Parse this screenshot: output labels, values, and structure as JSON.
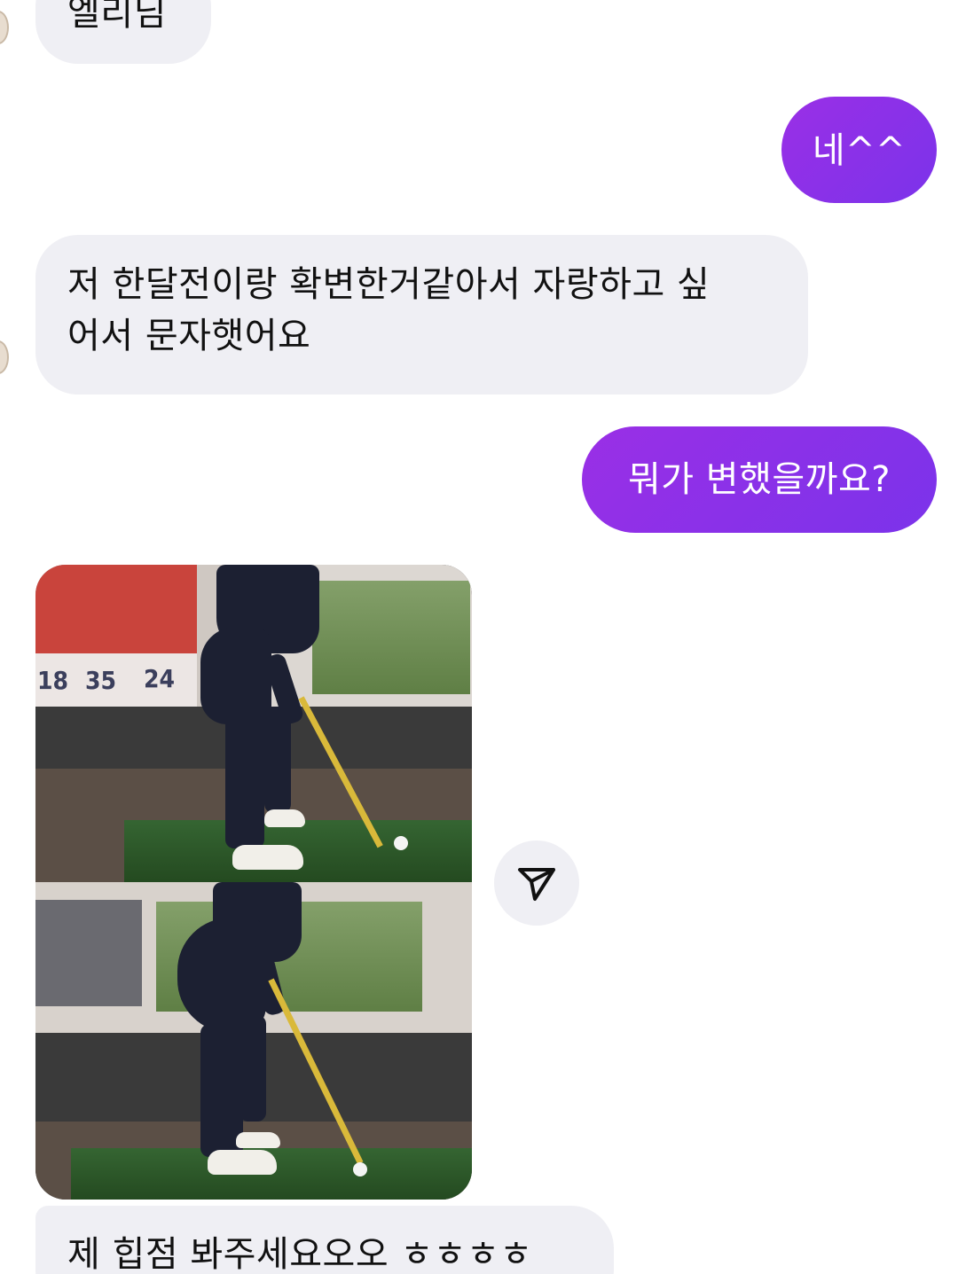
{
  "messages": [
    {
      "id": "m1",
      "direction": "incoming",
      "text": "엘리님"
    },
    {
      "id": "m2",
      "direction": "outgoing",
      "text": "네^^"
    },
    {
      "id": "m3",
      "direction": "incoming",
      "lines": [
        "저 한달전이랑 확변한거같아서 자랑하고 싶",
        "어서 문자햇어요"
      ]
    },
    {
      "id": "m4",
      "direction": "outgoing",
      "text": "뭐가 변했을까요?"
    },
    {
      "id": "m5",
      "direction": "incoming",
      "type": "photo"
    },
    {
      "id": "m6",
      "direction": "incoming",
      "text": "제 힙점 봐주세요오오 ㅎㅎㅎㅎ"
    }
  ],
  "photo": {
    "scoreboard": [
      "18",
      "35",
      "24"
    ]
  },
  "icons": {
    "share": "send-triangle-icon"
  },
  "colors": {
    "outgoing_bubble": "#8a2be2",
    "incoming_bubble": "#efeff4",
    "incoming_text": "#111111",
    "outgoing_text": "#ffffff"
  }
}
